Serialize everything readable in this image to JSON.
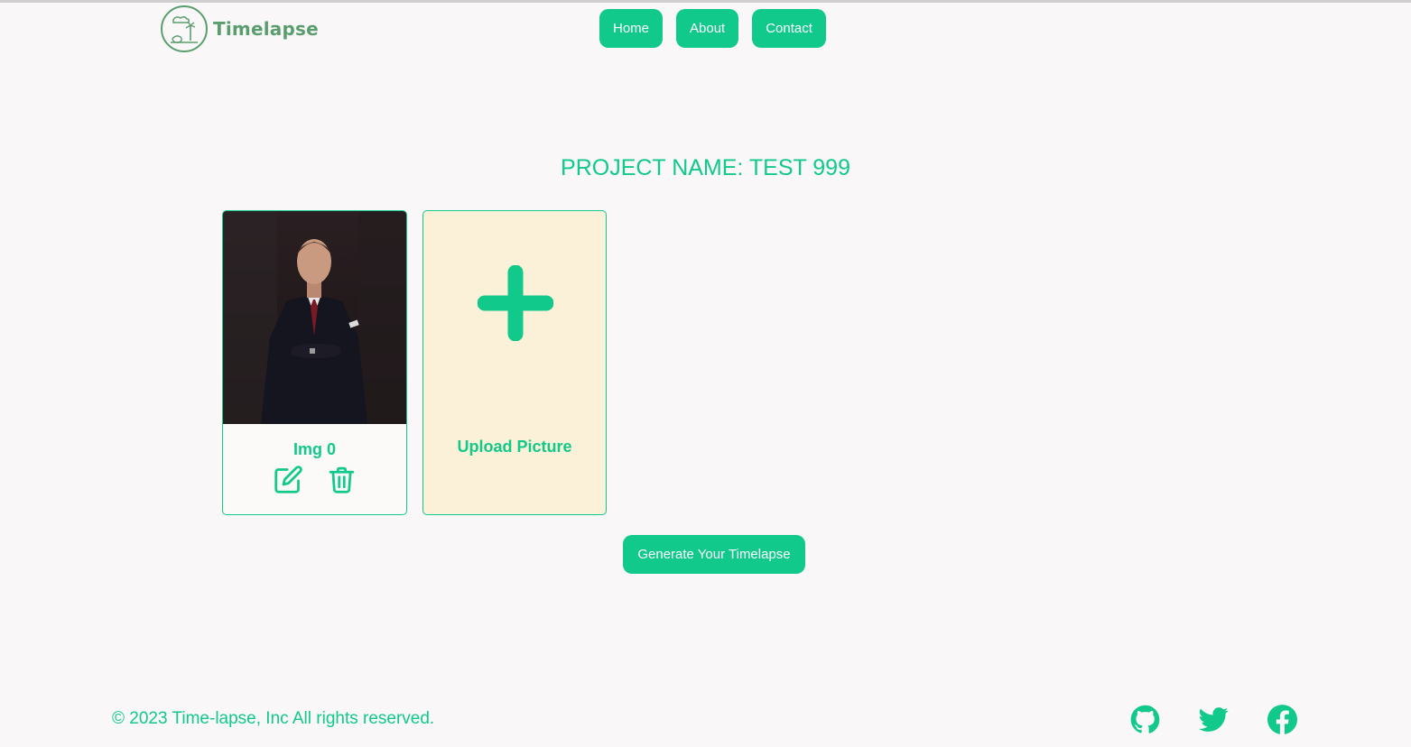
{
  "brand": {
    "name": "Timelapse"
  },
  "nav": {
    "home": "Home",
    "about": "About",
    "contact": "Contact"
  },
  "project": {
    "title": "PROJECT NAME: TEST 999"
  },
  "cards": {
    "image_card": {
      "caption": "Img 0"
    },
    "upload_card": {
      "label": "Upload Picture"
    }
  },
  "actions": {
    "generate": "Generate Your Timelapse"
  },
  "footer": {
    "copyright": "© 2023 Time-lapse, Inc All rights reserved."
  },
  "social": [
    "github-icon",
    "twitter-icon",
    "facebook-icon"
  ],
  "colors": {
    "accent": "#10c98a",
    "brand_text": "#5a9e6f",
    "background": "#f9f7f7",
    "upload_bg": "#fbf1d9"
  }
}
